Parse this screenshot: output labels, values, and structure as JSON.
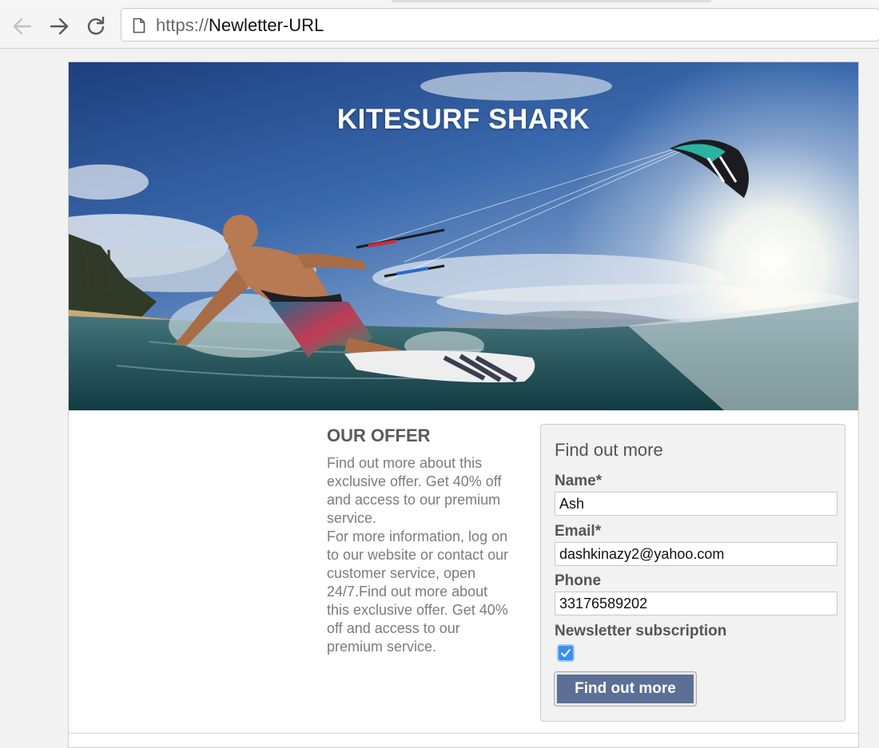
{
  "browser": {
    "url_scheme": "https://",
    "url_host": "Newletter-URL",
    "icons": [
      "back-arrow-icon",
      "forward-arrow-icon",
      "reload-icon",
      "page-icon"
    ]
  },
  "hero": {
    "title": "KITESURF SHARK"
  },
  "offer": {
    "title": "OUR OFFER",
    "paragraph1": "Find out more about this exclusive offer. Get 40% off and access to our premium service.",
    "paragraph2": "For more information, log on to our website or contact our customer service, open 24/7.Find out more about this exclusive offer. Get 40% off and access to our premium service."
  },
  "form": {
    "title": "Find out more",
    "name_label": "Name*",
    "name_value": "Ash",
    "email_label": "Email*",
    "email_value": "dashkinazy2@yahoo.com",
    "phone_label": "Phone",
    "phone_value": "33176589202",
    "newsletter_label": "Newsletter subscription",
    "newsletter_checked": true,
    "submit_label": "Find out more"
  },
  "colors": {
    "button": "#5c6f96",
    "checkbox": "#3b8ff0",
    "heading": "#5a5a5a",
    "body_text": "#7c7c7c"
  }
}
